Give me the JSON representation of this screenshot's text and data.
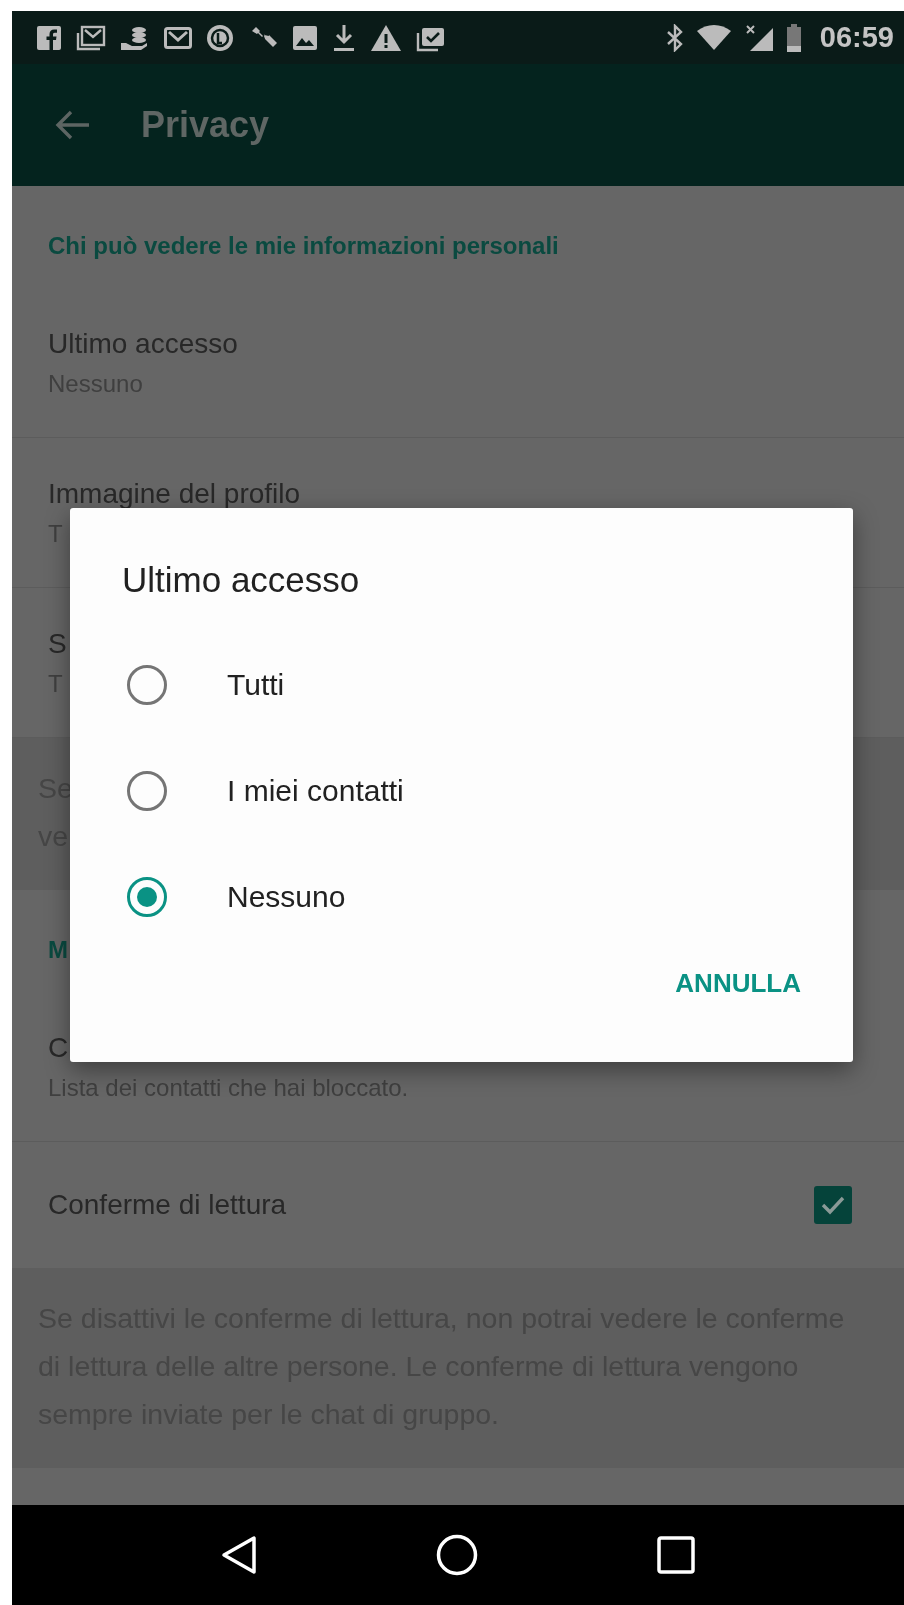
{
  "status_bar": {
    "time": "06:59"
  },
  "app_bar": {
    "title": "Privacy"
  },
  "sections": [
    {
      "header": "Chi può vedere le mie informazioni personali",
      "items": [
        {
          "kind": "setting",
          "title": "Ultimo accesso",
          "subtitle": "Nessuno"
        },
        {
          "kind": "setting",
          "title": "Immagine del profilo",
          "subtitle": "T"
        },
        {
          "kind": "setting",
          "title": "S",
          "subtitle": "T"
        }
      ],
      "note_lines": [
        "Se",
        "ve"
      ]
    },
    {
      "header": "M",
      "items": [
        {
          "kind": "setting",
          "title": "C",
          "subtitle": "Lista dei contatti che hai bloccato."
        },
        {
          "kind": "checkbox",
          "title": "Conferme di lettura",
          "checked": true
        }
      ],
      "note_lines": [
        "Se disattivi le conferme di lettura, non potrai vedere le conferme di lettura delle altre persone. Le conferme di lettura vengono sempre inviate per le chat di gruppo."
      ]
    }
  ],
  "dialog": {
    "title": "Ultimo accesso",
    "options": [
      {
        "label": "Tutti",
        "selected": false
      },
      {
        "label": "I miei contatti",
        "selected": false
      },
      {
        "label": "Nessuno",
        "selected": true
      }
    ],
    "button": "ANNULLA"
  }
}
